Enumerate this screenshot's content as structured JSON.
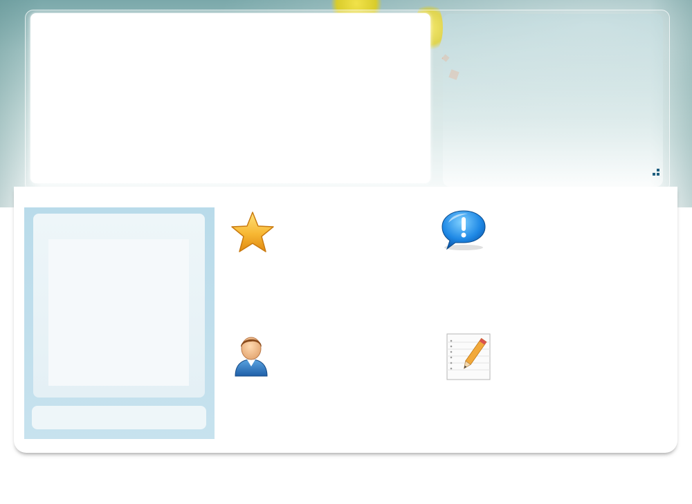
{
  "header": {
    "panel_text": ""
  },
  "sidebar": {
    "heading": "",
    "footer": ""
  },
  "features": [
    {
      "icon": "star-icon",
      "text": ""
    },
    {
      "icon": "info-bubble-icon",
      "text": ""
    },
    {
      "icon": "user-icon",
      "text": ""
    },
    {
      "icon": "notepad-pencil-icon",
      "text": ""
    }
  ],
  "colors": {
    "header_teal": "#7aa8aa",
    "sidebar_blue": "#b9dbea",
    "accent_dark_blue": "#1f5f7f"
  }
}
